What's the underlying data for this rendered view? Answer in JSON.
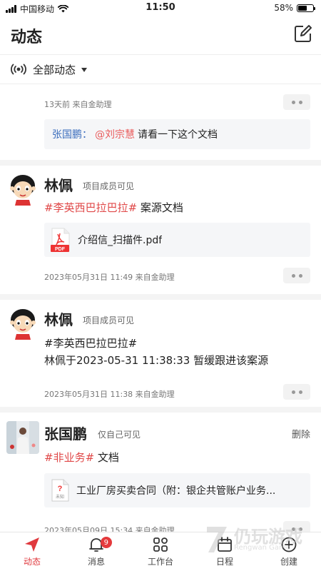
{
  "status_bar": {
    "carrier": "中国移动",
    "time": "11:50",
    "battery": "58%",
    "battery_level": 0.58
  },
  "header": {
    "title": "动态",
    "compose_icon": "edit-icon"
  },
  "filter": {
    "label": "全部动态",
    "icon": "broadcast-icon"
  },
  "comment_item": {
    "meta": "13天前 来自金助理",
    "author": "张国鹏：",
    "mention": "@刘宗慧",
    "text": "请看一下这个文档"
  },
  "posts": [
    {
      "author": "林佩",
      "visibility": "项目成员可见",
      "tag": "#李英西巴拉巴拉#",
      "text": "案源文档",
      "attachment": {
        "name": "介绍信_扫描件.pdf",
        "type_label": "PDF"
      },
      "meta": "2023年05月31日 11:49 来自金助理"
    },
    {
      "author": "林佩",
      "visibility": "项目成员可见",
      "line1": "#李英西巴拉巴拉#",
      "line2": "林佩于2023-05-31 11:38:33 暂缓跟进该案源",
      "meta": "2023年05月31日 11:38 来自金助理"
    },
    {
      "author": "张国鹏",
      "visibility": "仅自己可见",
      "delete_label": "删除",
      "tag": "#非业务#",
      "text": "文档",
      "attachment": {
        "name": "工业厂房买卖合同（附：银企共管账户业务...",
        "type_label": "未知"
      },
      "meta": "2023年05月09日 15:34 来自金助理"
    }
  ],
  "tabs": [
    {
      "label": "动态",
      "icon": "send-icon",
      "active": true
    },
    {
      "label": "消息",
      "icon": "bell-icon",
      "badge": "9"
    },
    {
      "label": "工作台",
      "icon": "grid-icon"
    },
    {
      "label": "日程",
      "icon": "calendar-icon"
    },
    {
      "label": "创建",
      "icon": "plus-circle-icon"
    }
  ],
  "watermark": {
    "text": "仍玩游戏",
    "sub": "Rengwan Game"
  },
  "colors": {
    "accent": "#e0393e",
    "tag": "#e04848",
    "mention": "#e95c5c",
    "author_link": "#3b6dbd"
  }
}
